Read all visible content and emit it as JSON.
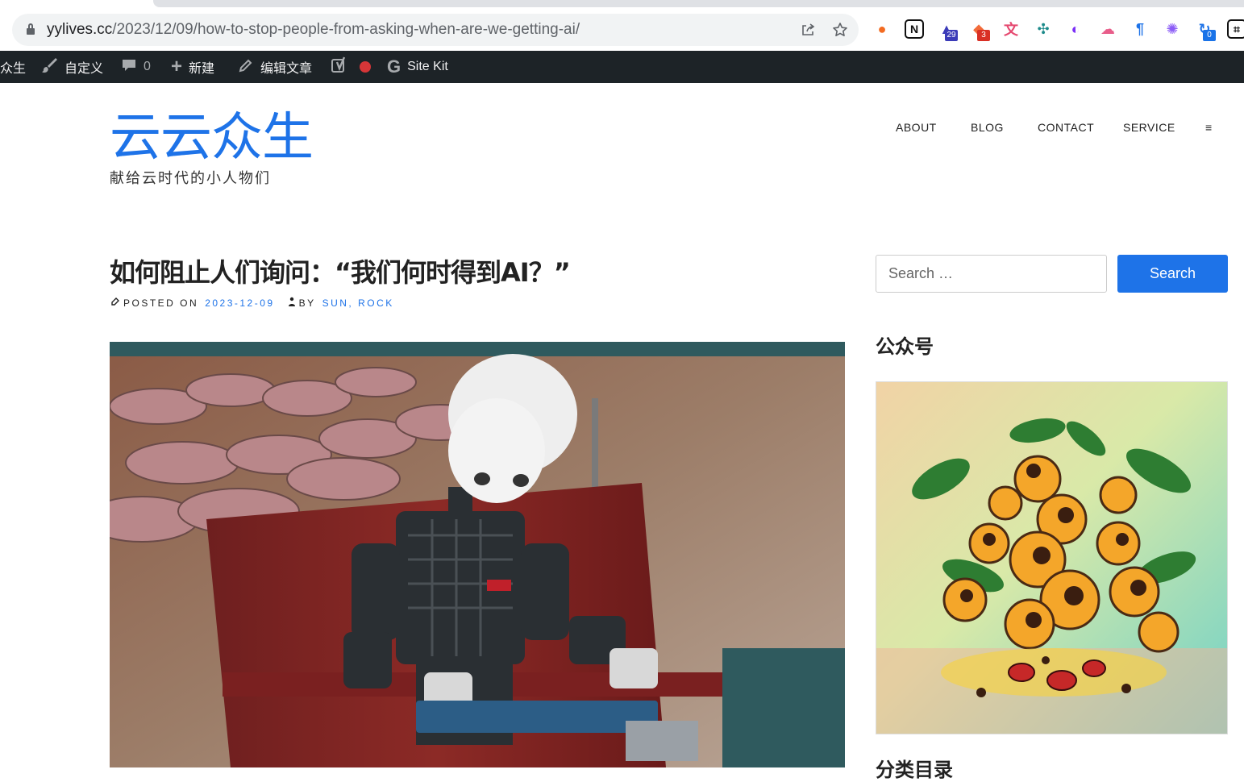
{
  "browser": {
    "url_host": "yylives.cc",
    "url_path": "/2023/12/09/how-to-stop-people-from-asking-when-are-we-getting-ai/",
    "extensions": [
      {
        "icon": "circle-extension-icon",
        "color": "#f36b21",
        "badge": ""
      },
      {
        "icon": "notion-icon",
        "color": "#111111",
        "badge": ""
      },
      {
        "icon": "graduation-cap-icon",
        "color": "#3b3bb8",
        "badge": "29"
      },
      {
        "icon": "cards-icon",
        "color": "#f26b3a",
        "badge": "3"
      },
      {
        "icon": "translate-icon",
        "color": "#e5486f",
        "badge": ""
      },
      {
        "icon": "network-icon",
        "color": "#1c8a8a",
        "badge": ""
      },
      {
        "icon": "chart-icon",
        "color": "#7b2ff7",
        "badge": ""
      },
      {
        "icon": "cloud-icon",
        "color": "#e85d8a",
        "badge": ""
      },
      {
        "icon": "paragraph-icon",
        "color": "#1e73e8",
        "badge": ""
      },
      {
        "icon": "openai-icon",
        "color": "#8b5cf6",
        "badge": ""
      },
      {
        "icon": "sync-icon",
        "color": "#1e73e8",
        "badge": "0"
      },
      {
        "icon": "terminal-icon",
        "color": "#111111",
        "badge": ""
      }
    ]
  },
  "adminbar": {
    "site": "众生",
    "customize": "自定义",
    "comments": "0",
    "new": "新建",
    "edit": "编辑文章",
    "sitekit": "Site Kit"
  },
  "site": {
    "title": "云云众生",
    "tagline": "献给云时代的小人物们",
    "nav": [
      "ABOUT",
      "BLOG",
      "CONTACT",
      "SERVICE",
      "≡"
    ]
  },
  "post": {
    "title": "如何阻止人们询问：“我们何时得到AI？”",
    "posted_on_label": "POSTED ON",
    "date": "2023-12-09",
    "by_label": "BY",
    "author": "SUN, ROCK"
  },
  "sidebar": {
    "search_placeholder": "Search …",
    "search_button": "Search",
    "widget_wechat": "公众号",
    "widget_categories": "分类目录"
  }
}
